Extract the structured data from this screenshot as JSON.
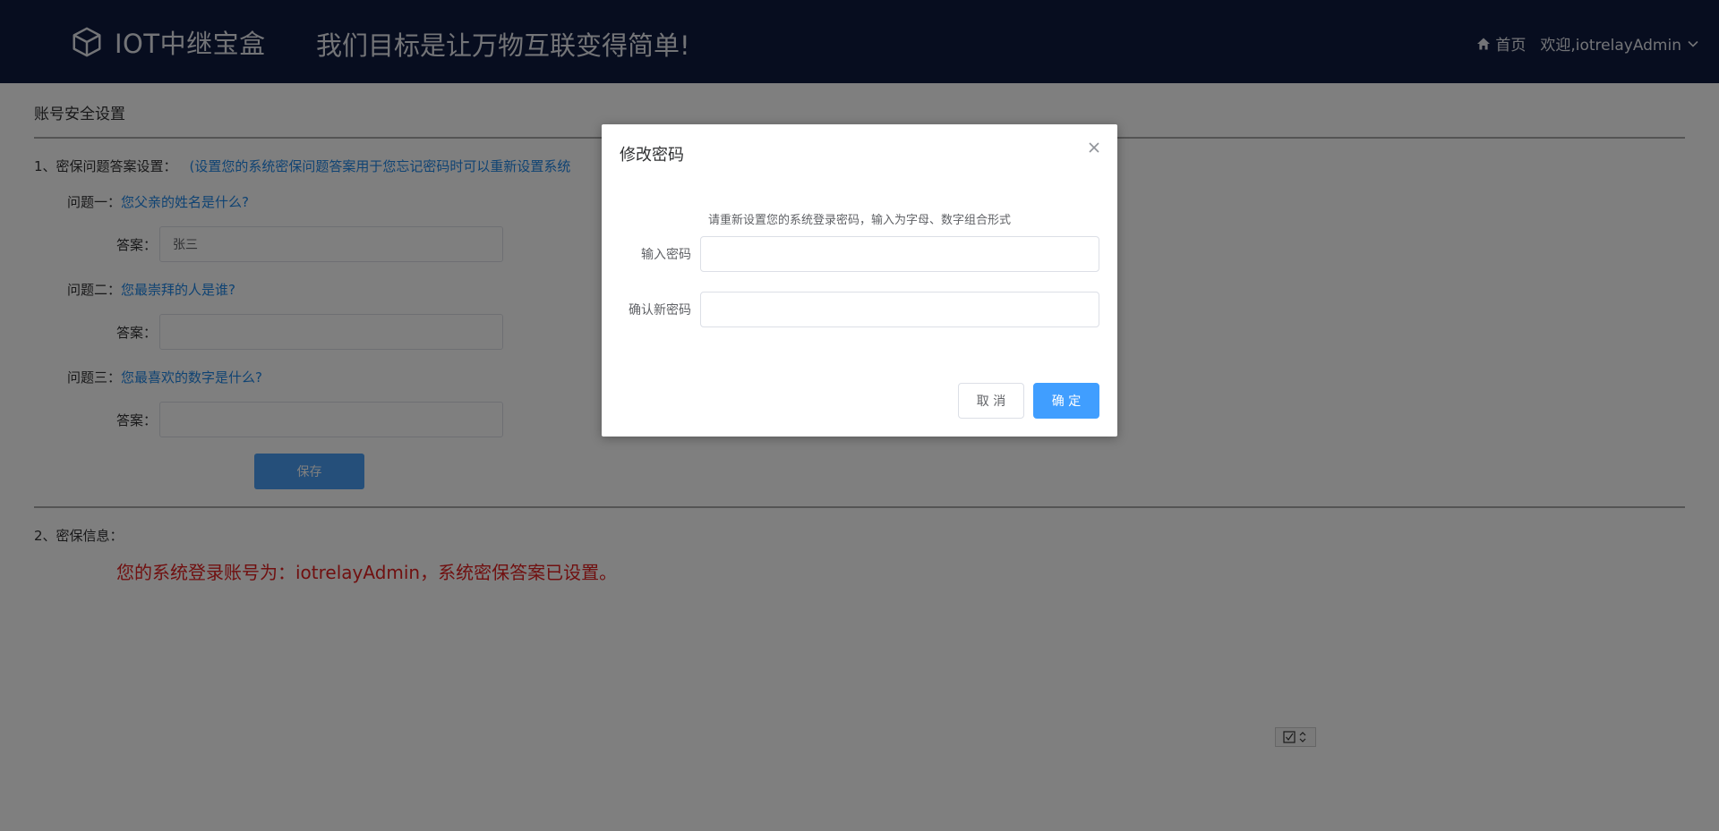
{
  "header": {
    "brand_name": "IOT中继宝盒",
    "slogan": "我们目标是让万物互联变得简单!",
    "home_label": "首页",
    "welcome": "欢迎,iotrelayAdmin",
    "brand_icon": "cube-icon",
    "home_icon": "home-icon",
    "user_menu_icon": "chevron-down-icon"
  },
  "page": {
    "title": "账号安全设置",
    "section1": {
      "label": "1、密保问题答案设置：",
      "hint": "(设置您的系统密保问题答案用于您忘记密码时可以重新设置系统"
    },
    "questions": [
      {
        "label": "问题一：",
        "text": "您父亲的姓名是什么?",
        "answer_label": "答案：",
        "answer_value": "张三"
      },
      {
        "label": "问题二：",
        "text": "您最崇拜的人是谁?",
        "answer_label": "答案：",
        "answer_value": ""
      },
      {
        "label": "问题三：",
        "text": "您最喜欢的数字是什么?",
        "answer_label": "答案：",
        "answer_value": ""
      }
    ],
    "save_label": "保存",
    "section2": {
      "label": "2、密保信息："
    },
    "info_text": "您的系统登录账号为：iotrelayAdmin，系统密保答案已设置。"
  },
  "dialog": {
    "title": "修改密码",
    "hint": "请重新设置您的系统登录密码，输入为字母、数字组合形式",
    "password_label": "输入密码",
    "password_value": "",
    "confirm_label": "确认新密码",
    "confirm_value": "",
    "cancel_label": "取 消",
    "ok_label": "确 定",
    "close_icon": "close-icon"
  },
  "colors": {
    "header_bg": "#0e1a3f",
    "link_blue": "#1f86e6",
    "alert_red": "#e02020",
    "primary": "#409eff"
  }
}
